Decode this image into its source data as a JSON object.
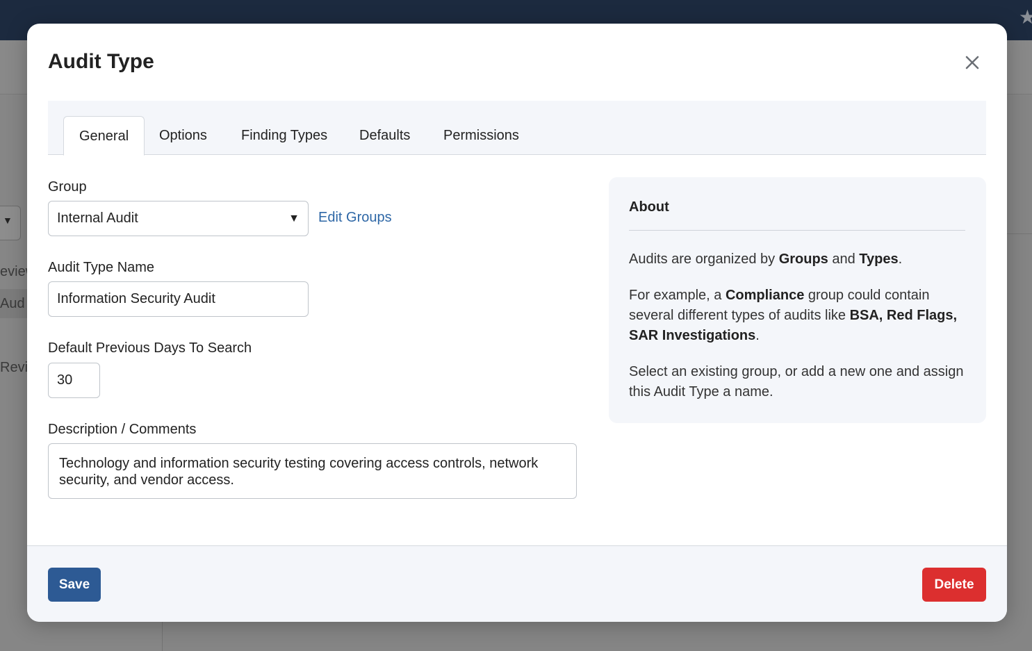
{
  "background": {
    "sidebar_fragments": [
      "eview",
      "Aud",
      "Revi"
    ]
  },
  "modal": {
    "title": "Audit Type",
    "tabs": [
      {
        "label": "General",
        "active": true
      },
      {
        "label": "Options",
        "active": false
      },
      {
        "label": "Finding Types",
        "active": false
      },
      {
        "label": "Defaults",
        "active": false
      },
      {
        "label": "Permissions",
        "active": false
      }
    ],
    "form": {
      "group_label": "Group",
      "group_value": "Internal Audit",
      "edit_groups_link": "Edit Groups",
      "name_label": "Audit Type Name",
      "name_value": "Information Security Audit",
      "days_label": "Default Previous Days To Search",
      "days_value": "30",
      "description_label": "Description / Comments",
      "description_value": "Technology and information security testing covering access controls, network security, and vendor access."
    },
    "about": {
      "title": "About",
      "p1": {
        "pre": "Audits are organized by ",
        "b1": "Groups",
        "mid": " and ",
        "b2": "Types",
        "post": "."
      },
      "p2": {
        "pre": "For example, a ",
        "b1": "Compliance",
        "mid": " group could contain several different types of audits like ",
        "b2": "BSA, Red Flags, SAR Investigations",
        "post": "."
      },
      "p3": "Select an existing group, or add a new one and assign this Audit Type a name."
    },
    "footer": {
      "save_label": "Save",
      "delete_label": "Delete"
    }
  },
  "colors": {
    "primary": "#2d5a94",
    "danger": "#dc2f2f",
    "link": "#2e67a6",
    "topbar": "#1c2a3f"
  },
  "icons": {
    "close": "close-icon",
    "star": "star-icon",
    "caret": "caret-down-icon"
  }
}
